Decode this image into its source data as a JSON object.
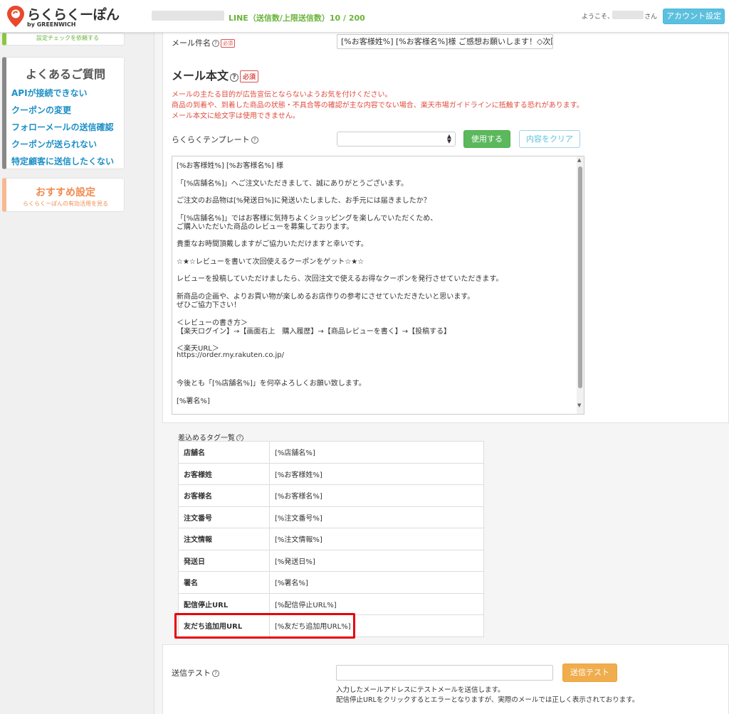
{
  "header": {
    "brand": "らくらくーぽん",
    "brand_sub": "by GREENWICH",
    "line_count": "LINE（送信数/上限送信数）10 / 200",
    "welcome": "ようこそ、",
    "welcome_suffix": "さん",
    "account_button": "アカウント設定"
  },
  "sidebar": {
    "top_card_text": "設定チェックを依頼する",
    "faq_title": "よくあるご質問",
    "faq_links": [
      "APIが接続できない",
      "クーポンの変更",
      "フォローメールの送信確認",
      "クーポンが送られない",
      "特定顧客に送信したくない"
    ],
    "recommend_title": "おすすめ設定",
    "recommend_sub": "らくらくーぽんの有効活用を見る"
  },
  "form": {
    "subject_label": "メール件名",
    "required_badge": "必須",
    "subject_value": "[%お客様姓%] [%お客様名%]様 ご感想お願いします！◇次回使えるクーポン",
    "body_title": "メール本文",
    "warnings": [
      "メールの主たる目的が広告宣伝とならないようお気を付けください。",
      "商品の到着や、到着した商品の状態・不具合等の確認が主な内容でない場合、楽天市場ガイドラインに抵触する恐れがあります。",
      "メール本文に絵文字は使用できません。"
    ],
    "template_label": "らくらくテンプレート",
    "use_button": "使用する",
    "clear_button": "内容をクリア",
    "body_lines": [
      "[%お客様姓%] [%お客様名%] 様",
      "",
      "「[%店舗名%]」へご注文いただきまして、誠にありがとうございます。",
      "",
      "ご注文のお品物は[%発送日%]に発送いたしました、お手元には届きましたか？",
      "",
      "「[%店舗名%]」ではお客様に気持ちよくショッピングを楽しんでいただくため、",
      "ご購入いただいた商品のレビューを募集しております。",
      "",
      "貴重なお時間頂戴しますがご協力いただけますと幸いです。",
      "",
      "☆★☆レビューを書いて次回使えるクーポンをゲット☆★☆",
      "",
      "レビューを投稿していただけましたら、次回注文で使えるお得なクーポンを発行させていただきます。",
      "",
      "新商品の企画や、よりお買い物が楽しめるお店作りの参考にさせていただきたいと思います。",
      "ぜひご協力下さい！",
      "",
      "＜レビューの書き方＞",
      "【楽天ログイン】→【画面右上　購入履歴】→【商品レビューを書く】→【投稿する】",
      "",
      "＜楽天URL＞",
      "https://order.my.rakuten.co.jp/",
      "",
      "",
      "今後とも「[%店舗名%]」を何卒よろしくお願い致します。",
      "",
      "[%署名%]"
    ]
  },
  "tags": {
    "caption": "差込めるタグ一覧",
    "rows": [
      {
        "name": "店舗名",
        "tag": "[%店舗名%]"
      },
      {
        "name": "お客様姓",
        "tag": "[%お客様姓%]"
      },
      {
        "name": "お客様名",
        "tag": "[%お客様名%]"
      },
      {
        "name": "注文番号",
        "tag": "[%注文番号%]"
      },
      {
        "name": "注文情報",
        "tag": "[%注文情報%]"
      },
      {
        "name": "発送日",
        "tag": "[%発送日%]"
      },
      {
        "name": "署名",
        "tag": "[%署名%]"
      },
      {
        "name": "配信停止URL",
        "tag": "[%配信停止URL%]"
      },
      {
        "name": "友だち追加用URL",
        "tag": "[%友だち追加用URL%]"
      }
    ]
  },
  "test_send": {
    "label": "送信テスト",
    "email_value": "",
    "button": "送信テスト",
    "notes": [
      "入力したメールアドレスにテストメールを送信します。",
      "配信停止URLをクリックするとエラーとなりますが、実際のメールでは正しく表示されております。"
    ]
  },
  "colors": {
    "accent_blue": "#5bc0de",
    "link_blue": "#1e8fc6",
    "green": "#5cb85c",
    "orange": "#f0ad4e",
    "warning_red": "#e04b3d",
    "highlight_red": "#e8000b"
  }
}
